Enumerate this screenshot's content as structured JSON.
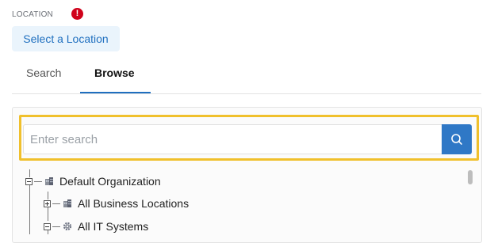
{
  "location_field": {
    "label": "LOCATION",
    "select_button_label": "Select a Location",
    "error_icon": "exclamation-circle-icon",
    "error_glyph": "!"
  },
  "tabs": [
    {
      "label": "Search",
      "active": false
    },
    {
      "label": "Browse",
      "active": true
    }
  ],
  "search": {
    "placeholder": "Enter search",
    "value": "",
    "button_icon": "search-icon"
  },
  "tree": [
    {
      "label": "Default Organization",
      "expanded": true,
      "icon": "building-icon"
    },
    {
      "label": "All Business Locations",
      "expanded": false,
      "icon": "building-icon"
    },
    {
      "label": "All IT Systems",
      "expanded": true,
      "icon": "gear-icon"
    }
  ],
  "colors": {
    "accent": "#1f6fbf",
    "highlight": "#f0c02c",
    "error": "#d0021b"
  }
}
